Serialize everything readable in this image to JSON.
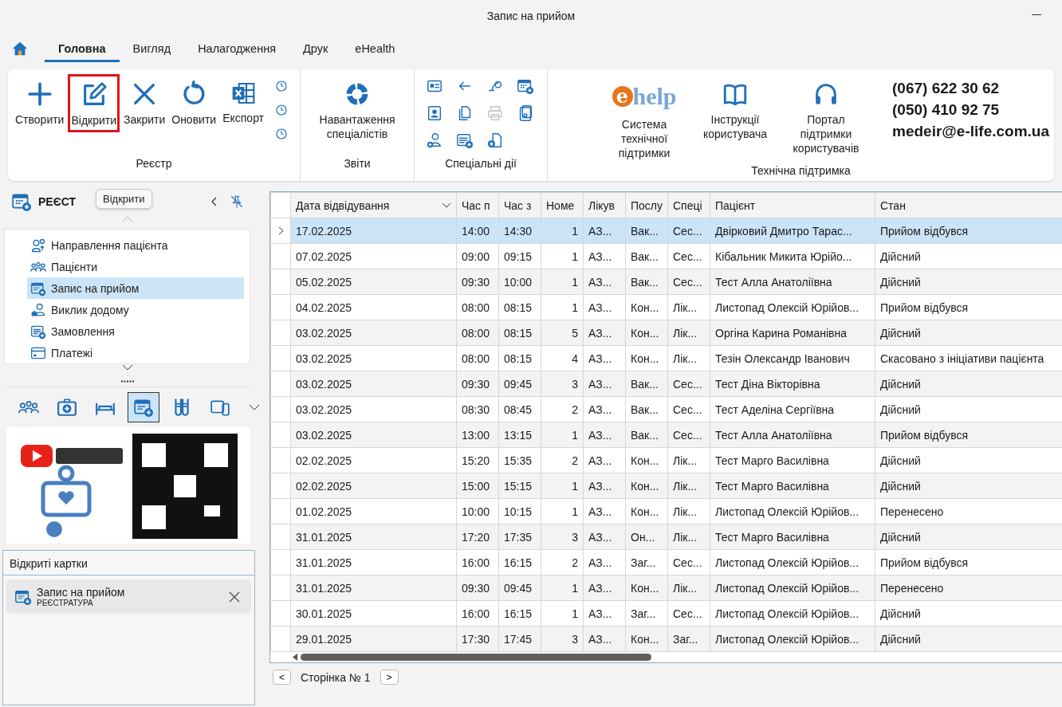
{
  "window": {
    "title": "Запис на прийом"
  },
  "tabs": [
    {
      "label": "Головна",
      "selected": true
    },
    {
      "label": "Вигляд",
      "selected": false
    },
    {
      "label": "Налагодження",
      "selected": false
    },
    {
      "label": "Друк",
      "selected": false
    },
    {
      "label": "eHealth",
      "selected": false
    }
  ],
  "ribbon": {
    "groups": [
      {
        "label": "Реєстр",
        "buttons": [
          {
            "label": "Створити",
            "highlighted": false
          },
          {
            "label": "Відкрити",
            "highlighted": true
          },
          {
            "label": "Закрити",
            "highlighted": false
          },
          {
            "label": "Оновити",
            "highlighted": false
          },
          {
            "label": "Експорт",
            "highlighted": false
          }
        ]
      },
      {
        "label": "Звіти",
        "buttons": [
          {
            "label": "Навантаження спеціалістів",
            "highlighted": false
          }
        ]
      },
      {
        "label": "Спеціальні дії",
        "grid": [
          {
            "disabled": false
          },
          {
            "disabled": false
          },
          {
            "disabled": false
          },
          {
            "disabled": false
          },
          {
            "disabled": false
          },
          {
            "disabled": false
          },
          {
            "disabled": true
          },
          {
            "disabled": false
          },
          {
            "disabled": false
          },
          {
            "disabled": false
          },
          {
            "disabled": false
          }
        ]
      },
      {
        "label": "Технічна підтримка",
        "logo": {
          "mark": "e",
          "text": "help"
        },
        "buttons": [
          {
            "label": "Система технічної підтримки",
            "highlighted": false
          },
          {
            "label": "Інструкції користувача",
            "highlighted": false
          },
          {
            "label": "Портал підтримки користувачів",
            "highlighted": false
          }
        ],
        "contacts": [
          "(067) 622 30 62",
          "(050) 410 92 75",
          "medeir@e-life.com.ua"
        ]
      }
    ]
  },
  "sidebar": {
    "title": "РЕЄСТ",
    "tooltip": "Відкрити",
    "items": [
      {
        "label": "Направлення пацієнта",
        "selected": false
      },
      {
        "label": "Пацієнти",
        "selected": false
      },
      {
        "label": "Запис на прийом",
        "selected": true
      },
      {
        "label": "Виклик додому",
        "selected": false
      },
      {
        "label": "Замовлення",
        "selected": false
      },
      {
        "label": "Платежі",
        "selected": false
      }
    ],
    "modules": [
      {
        "selected": false
      },
      {
        "selected": false
      },
      {
        "selected": false
      },
      {
        "selected": true
      },
      {
        "selected": false
      },
      {
        "selected": false
      }
    ]
  },
  "open_cards": {
    "title": "Відкриті картки",
    "cards": [
      {
        "title": "Запис на прийом",
        "subtitle": "РЕЄСТРАТУРА"
      }
    ]
  },
  "table": {
    "columns": [
      "Дата відвідування",
      "Час п",
      "Час з",
      "Номе",
      "Лікув",
      "Послу",
      "Спеці",
      "Пацієнт",
      "Стан"
    ],
    "rows": [
      {
        "selected": true,
        "cells": [
          "17.02.2025",
          "14:00",
          "14:30",
          "1",
          "АЗ...",
          "Вак...",
          "Сес...",
          "Двірковий Дмитро Тарас...",
          "Прийом відбувся"
        ]
      },
      {
        "selected": false,
        "cells": [
          "07.02.2025",
          "09:00",
          "09:15",
          "1",
          "АЗ...",
          "Вак...",
          "Сес...",
          "Кібальник Микита Юрійо...",
          "Дійсний"
        ]
      },
      {
        "selected": false,
        "cells": [
          "05.02.2025",
          "09:30",
          "10:00",
          "1",
          "АЗ...",
          "Вак...",
          "Сес...",
          "Тест Алла Анатоліївна",
          "Дійсний"
        ]
      },
      {
        "selected": false,
        "cells": [
          "04.02.2025",
          "08:00",
          "08:15",
          "1",
          "АЗ...",
          "Кон...",
          "Лік...",
          "Листопад Олексій Юрійов...",
          "Прийом відбувся"
        ]
      },
      {
        "selected": false,
        "cells": [
          "03.02.2025",
          "08:00",
          "08:15",
          "5",
          "АЗ...",
          "Кон...",
          "Лік...",
          "Оргіна Карина Романівна",
          "Дійсний"
        ]
      },
      {
        "selected": false,
        "cells": [
          "03.02.2025",
          "08:00",
          "08:15",
          "4",
          "АЗ...",
          "Кон...",
          "Лік...",
          "Тезін Олександр Іванович",
          "Скасовано з ініціативи пацієнта"
        ]
      },
      {
        "selected": false,
        "cells": [
          "03.02.2025",
          "09:30",
          "09:45",
          "3",
          "АЗ...",
          "Вак...",
          "Сес...",
          "Тест Діна Вікторівна",
          "Дійсний"
        ]
      },
      {
        "selected": false,
        "cells": [
          "03.02.2025",
          "08:30",
          "08:45",
          "2",
          "АЗ...",
          "Вак...",
          "Сес...",
          "Тест Аделіна Сергіївна",
          "Дійсний"
        ]
      },
      {
        "selected": false,
        "cells": [
          "03.02.2025",
          "13:00",
          "13:15",
          "1",
          "АЗ...",
          "Вак...",
          "Сес...",
          "Тест Алла Анатоліївна",
          "Прийом відбувся"
        ]
      },
      {
        "selected": false,
        "cells": [
          "02.02.2025",
          "15:20",
          "15:35",
          "2",
          "АЗ...",
          "Кон...",
          "Лік...",
          "Тест Марго Василівна",
          "Дійсний"
        ]
      },
      {
        "selected": false,
        "cells": [
          "02.02.2025",
          "15:00",
          "15:15",
          "1",
          "АЗ...",
          "Кон...",
          "Лік...",
          "Тест Марго Василівна",
          "Дійсний"
        ]
      },
      {
        "selected": false,
        "cells": [
          "01.02.2025",
          "10:00",
          "10:15",
          "1",
          "АЗ...",
          "Кон...",
          "Лік...",
          "Листопад Олексій Юрійов...",
          "Перенесено"
        ]
      },
      {
        "selected": false,
        "cells": [
          "31.01.2025",
          "17:20",
          "17:35",
          "3",
          "АЗ...",
          "Он...",
          "Лік...",
          "Тест Марго Василівна",
          "Дійсний"
        ]
      },
      {
        "selected": false,
        "cells": [
          "31.01.2025",
          "16:00",
          "16:15",
          "2",
          "АЗ...",
          "Заг...",
          "Сес...",
          "Листопад Олексій Юрійов...",
          "Прийом відбувся"
        ]
      },
      {
        "selected": false,
        "cells": [
          "31.01.2025",
          "09:30",
          "09:45",
          "1",
          "АЗ...",
          "Кон...",
          "Лік...",
          "Листопад Олексій Юрійов...",
          "Перенесено"
        ]
      },
      {
        "selected": false,
        "cells": [
          "30.01.2025",
          "16:00",
          "16:15",
          "1",
          "АЗ...",
          "Заг...",
          "Сес...",
          "Листопад Олексій Юрійов...",
          "Дійсний"
        ]
      },
      {
        "selected": false,
        "cells": [
          "29.01.2025",
          "17:30",
          "17:45",
          "3",
          "АЗ...",
          "Кон...",
          "Заг...",
          "Листопад Олексій Юрійов...",
          "Дійсний"
        ]
      }
    ]
  },
  "pager": {
    "prev": "<",
    "label": "Сторінка № 1",
    "next": ">"
  }
}
